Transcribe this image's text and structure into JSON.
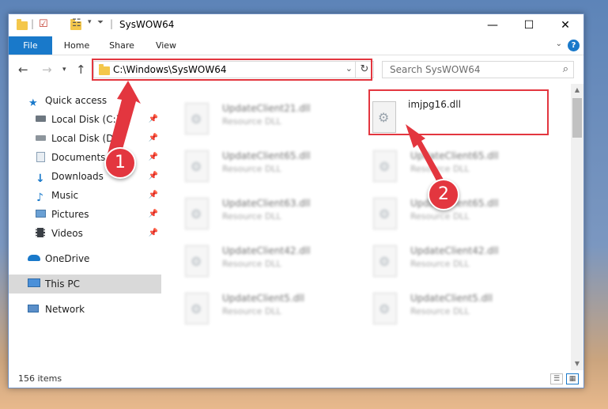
{
  "window": {
    "title": "SysWOW64",
    "controls": {
      "minimize": "—",
      "maximize": "☐",
      "close": "✕"
    }
  },
  "ribbon": {
    "tabs": [
      "File",
      "Home",
      "Share",
      "View"
    ],
    "help": "?"
  },
  "address": {
    "path": "C:\\Windows\\SysWOW64",
    "search_placeholder": "Search SysWOW64"
  },
  "sidebar": {
    "quick_access": "Quick access",
    "items": [
      {
        "label": "Local Disk (C:)",
        "icon": "drive-icon",
        "pinned": true
      },
      {
        "label": "Local Disk (D:)",
        "icon": "drive-icon",
        "pinned": true
      },
      {
        "label": "Documents",
        "icon": "documents-icon",
        "pinned": true
      },
      {
        "label": "Downloads",
        "icon": "download-icon",
        "pinned": true
      },
      {
        "label": "Music",
        "icon": "music-icon",
        "pinned": true
      },
      {
        "label": "Pictures",
        "icon": "pictures-icon",
        "pinned": true
      },
      {
        "label": "Videos",
        "icon": "videos-icon",
        "pinned": true
      }
    ],
    "onedrive": "OneDrive",
    "this_pc": "This PC",
    "network": "Network"
  },
  "files": {
    "highlighted": {
      "name": "imjpg16.dll"
    },
    "blurred_left": [
      {
        "name": "UpdateClient21.dll",
        "type": "Resource DLL"
      },
      {
        "name": "UpdateClient65.dll",
        "type": "Resource DLL"
      },
      {
        "name": "UpdateClient63.dll",
        "type": "Resource DLL"
      },
      {
        "name": "UpdateClient42.dll",
        "type": "Resource DLL"
      },
      {
        "name": "UpdateClient5.dll",
        "type": "Resource DLL"
      }
    ],
    "blurred_right": [
      {
        "name": "UpdateClient65.dll",
        "type": "Resource DLL"
      },
      {
        "name": "UpdateClient65.dll",
        "type": "Resource DLL"
      },
      {
        "name": "UpdateClient42.dll",
        "type": "Resource DLL"
      },
      {
        "name": "UpdateClient5.dll",
        "type": "Resource DLL"
      }
    ]
  },
  "status": {
    "item_count": "156 items"
  },
  "callouts": {
    "step1": "1",
    "step2": "2"
  },
  "colors": {
    "accent": "#1979ca",
    "callout_red": "#e3363f"
  }
}
